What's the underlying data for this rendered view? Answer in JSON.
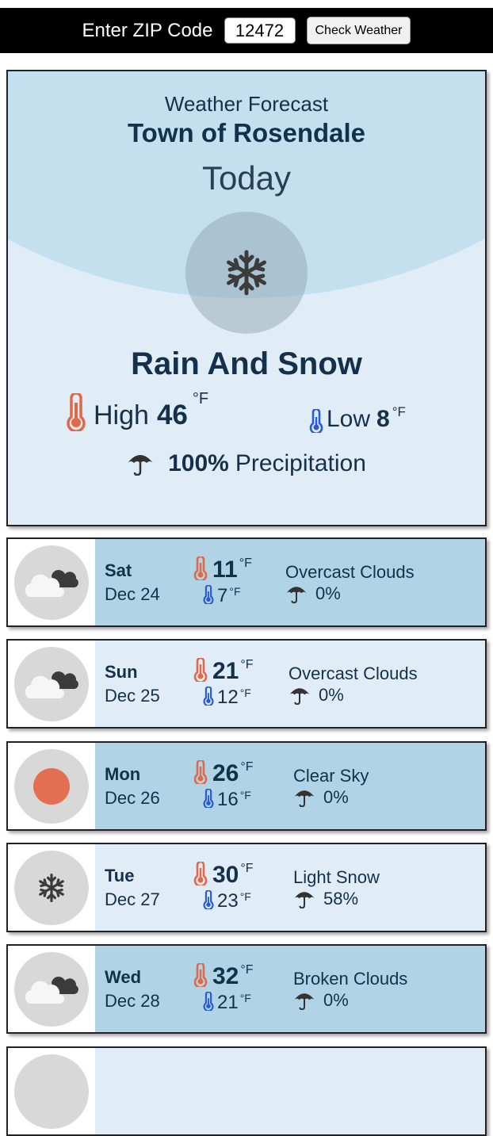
{
  "zip": {
    "label": "Enter ZIP Code",
    "value": "12472",
    "button": "Check Weather"
  },
  "today": {
    "heading": "Weather Forecast",
    "town": "Town of Rosendale",
    "day": "Today",
    "icon": "snowflake-icon",
    "condition": "Rain And Snow",
    "high_label": "High",
    "high": "46",
    "low_label": "Low",
    "low": "8",
    "unit": "°F",
    "precip": "100%",
    "precip_label": "Precipitation"
  },
  "forecast": [
    {
      "day": "Sat",
      "date": "Dec 24",
      "high": "11",
      "low": "7",
      "unit": "°F",
      "condition": "Overcast Clouds",
      "precip": "0%",
      "icon": "cloud-icon"
    },
    {
      "day": "Sun",
      "date": "Dec 25",
      "high": "21",
      "low": "12",
      "unit": "°F",
      "condition": "Overcast Clouds",
      "precip": "0%",
      "icon": "cloud-icon"
    },
    {
      "day": "Mon",
      "date": "Dec 26",
      "high": "26",
      "low": "16",
      "unit": "°F",
      "condition": "Clear Sky",
      "precip": "0%",
      "icon": "sun-icon"
    },
    {
      "day": "Tue",
      "date": "Dec 27",
      "high": "30",
      "low": "23",
      "unit": "°F",
      "condition": "Light Snow",
      "precip": "58%",
      "icon": "snowflake-icon"
    },
    {
      "day": "Wed",
      "date": "Dec 28",
      "high": "32",
      "low": "21",
      "unit": "°F",
      "condition": "Broken Clouds",
      "precip": "0%",
      "icon": "cloud-icon"
    }
  ],
  "colors": {
    "accent_dark": "#b0d3e6",
    "accent_light": "#e0edf7",
    "text": "#15304a",
    "thermo_hot": "#e0694a",
    "thermo_cold": "#2a5bd7",
    "sun": "#e26f52"
  }
}
